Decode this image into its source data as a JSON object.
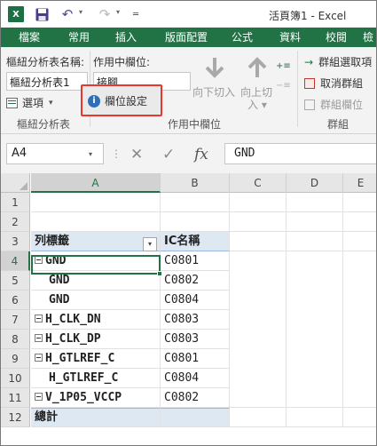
{
  "title_bar": {
    "app_logo": "X",
    "title": "活頁簿1 - Excel",
    "icons": [
      "excel-logo-icon",
      "save-icon",
      "undo-icon",
      "redo-icon",
      "customize-qat-icon"
    ],
    "undo_glyph": "↶",
    "redo_glyph": "↷",
    "dropdown_glyph": "▾",
    "more_glyph": "═"
  },
  "ribbon_tabs": [
    "檔案",
    "常用",
    "插入",
    "版面配置",
    "公式",
    "資料",
    "校閱",
    "檢"
  ],
  "ribbon": {
    "pivot_name_label": "樞紐分析表名稱:",
    "pivot_name_value": "樞紐分析表1",
    "options_label": "選項",
    "options_dropdown": "▾",
    "group_pivot": "樞紐分析表",
    "active_field_label": "作用中欄位:",
    "active_field_value": "接腳",
    "field_settings_label": "欄位設定",
    "drill_down_label": "向下切入",
    "drill_up_label": "向上切",
    "drill_up_label2": "入 ▾",
    "group_active_field": "作用中欄位",
    "group_selection_label": "群組選取項",
    "ungroup_label": "取消群組",
    "group_field_label": "群組欄位",
    "group_group": "群組"
  },
  "formula_bar": {
    "name_box": "A4",
    "name_box_dropdown": "▾",
    "cancel_glyph": "✕",
    "enter_glyph": "✓",
    "fx_glyph": "fx",
    "more_glyph": "⋮",
    "formula": "GND"
  },
  "grid": {
    "columns": [
      "A",
      "B",
      "C",
      "D",
      "E"
    ],
    "rows": [
      "1",
      "2",
      "3",
      "4",
      "5",
      "6",
      "7",
      "8",
      "9",
      "10",
      "11",
      "12"
    ],
    "header_row_label": "列標籤",
    "header_value_label": "IC名稱",
    "filter_glyph": "▾",
    "pivot_rows": [
      {
        "label": "GND",
        "value": "C0801"
      },
      {
        "label": "GND",
        "value": "C0802"
      },
      {
        "label": "GND",
        "value": "C0804"
      },
      {
        "label": "H_CLK_DN",
        "value": "C0803"
      },
      {
        "label": "H_CLK_DP",
        "value": "C0803"
      },
      {
        "label": "H_GTLREF_C",
        "value": "C0801"
      },
      {
        "label": "H_GTLREF_C",
        "value": "C0804"
      },
      {
        "label": "V_1P05_VCCP",
        "value": "C0802"
      }
    ],
    "total_label": "總計",
    "accent_color": "#217346",
    "pivot_header_color": "#dde8f3"
  }
}
